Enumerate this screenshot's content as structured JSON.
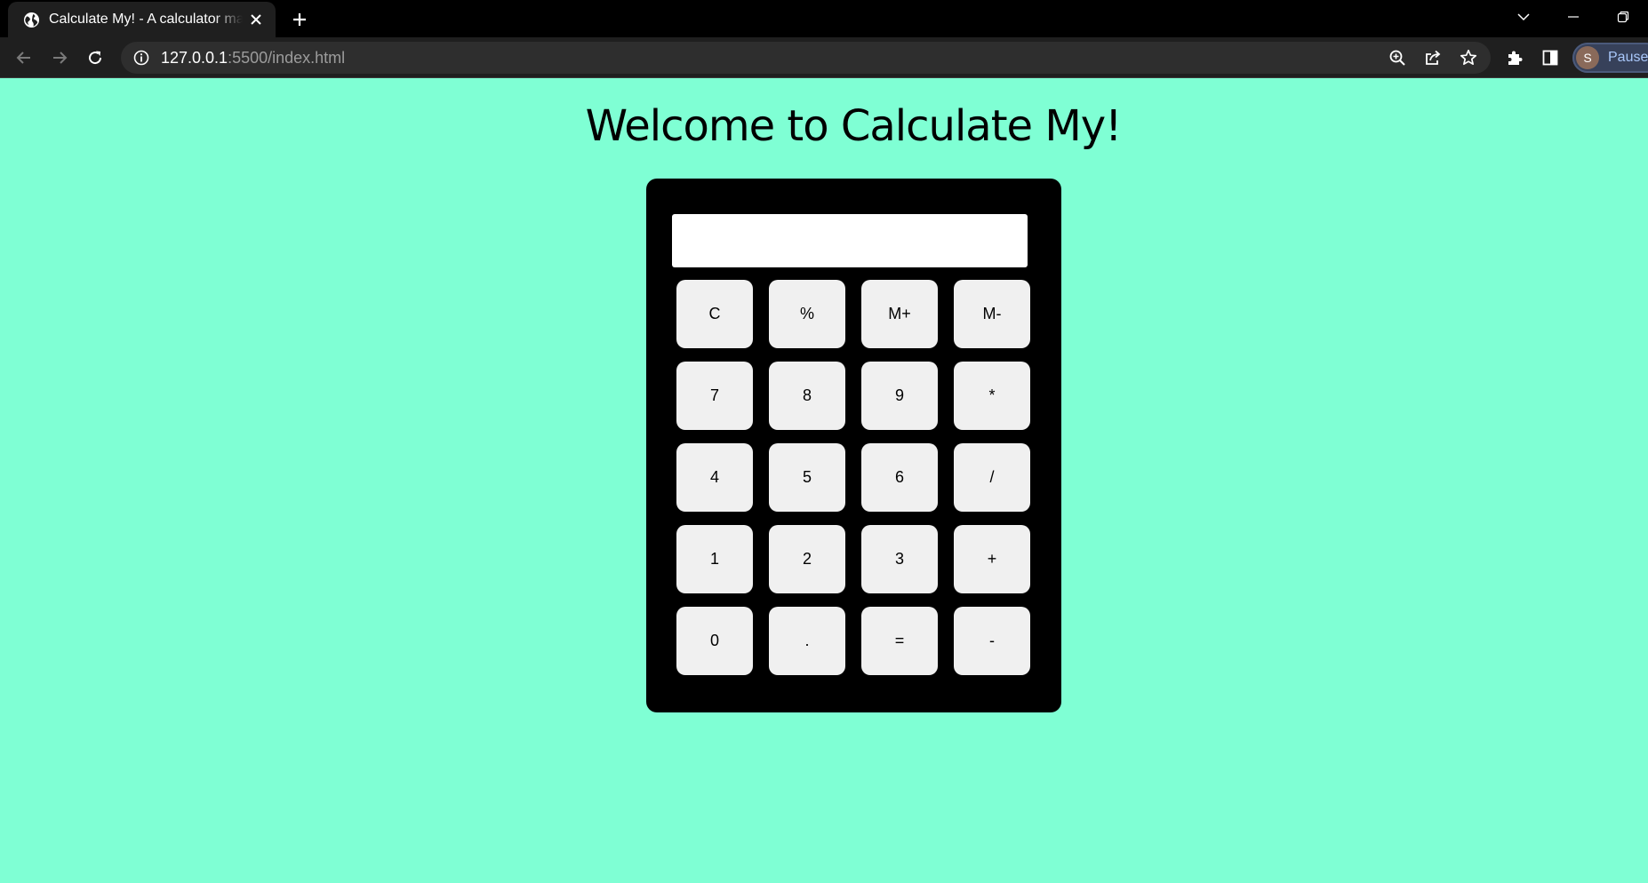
{
  "browser": {
    "tab_title": "Calculate My! - A calculator made",
    "url_host": "127.0.0.1",
    "url_rest": ":5500/index.html",
    "profile_initial": "S",
    "profile_status": "Paused"
  },
  "page": {
    "title": "Welcome to Calculate My!",
    "display_value": "",
    "keys": [
      "C",
      "%",
      "M+",
      "M-",
      "7",
      "8",
      "9",
      "*",
      "4",
      "5",
      "6",
      "/",
      "1",
      "2",
      "3",
      "+",
      "0",
      ".",
      "=",
      "-"
    ]
  },
  "colors": {
    "page_background": "#7fffd4",
    "calculator_body": "#000000",
    "key_background": "#f0f0f0",
    "display_background": "#ffffff"
  },
  "icons": {
    "favicon": "globe-icon",
    "tab_close": "close-icon",
    "new_tab": "plus-icon",
    "back": "arrow-left-icon",
    "forward": "arrow-right-icon",
    "reload": "reload-icon",
    "site_info": "info-icon",
    "zoom": "zoom-icon",
    "share": "share-icon",
    "bookmark": "star-icon",
    "extensions": "puzzle-icon",
    "side_panel": "side-panel-icon"
  }
}
